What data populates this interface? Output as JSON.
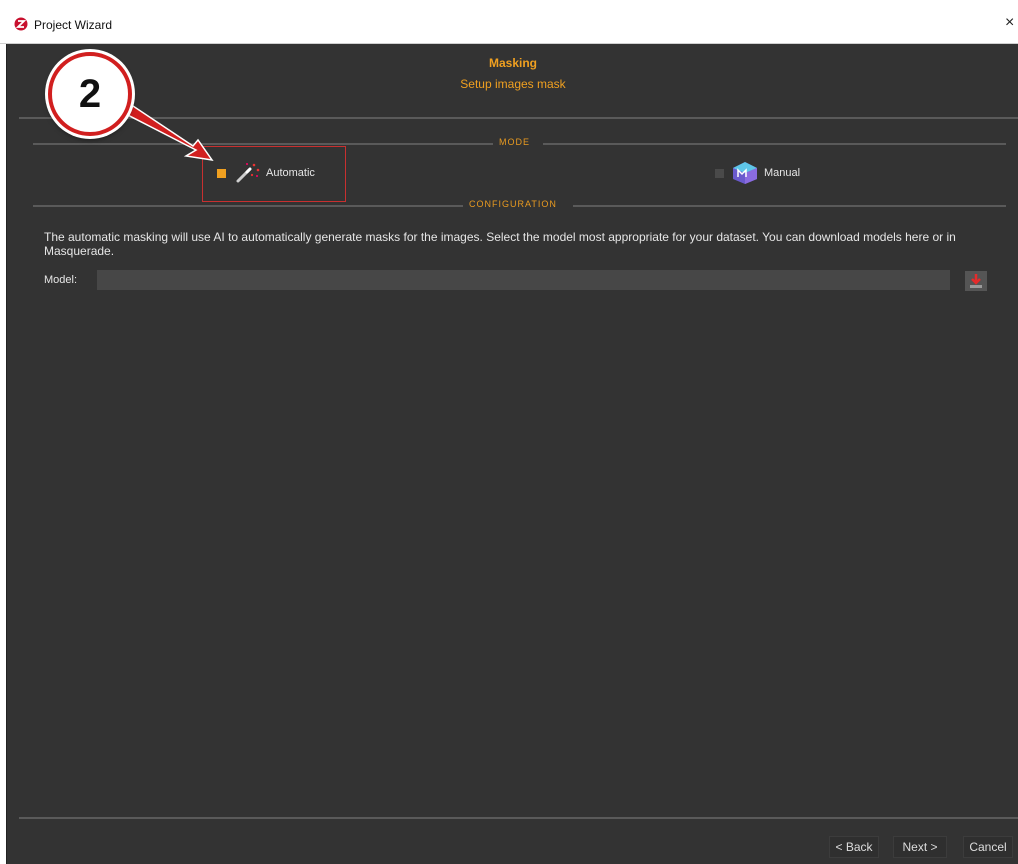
{
  "window": {
    "title": "Project Wizard",
    "close_glyph": "×"
  },
  "header": {
    "title": "Masking",
    "subtitle": "Setup images mask"
  },
  "mode_section": {
    "label": "MODE",
    "options": [
      {
        "label": "Automatic",
        "icon": "magic-wand-icon",
        "selected": true
      },
      {
        "label": "Manual",
        "icon": "manual-cube-icon",
        "selected": false
      }
    ]
  },
  "configuration_section": {
    "label": "CONFIGURATION",
    "description": "The automatic masking will use AI to automatically generate masks for the images. Select the model most appropriate for your dataset. You can download models here or in Masquerade.",
    "model_label": "Model:",
    "model_value": ""
  },
  "footer": {
    "back_label": "< Back",
    "next_label": "Next >",
    "cancel_label": "Cancel"
  },
  "annotation": {
    "step_number": "2"
  },
  "colors": {
    "accent": "#f0a020",
    "background": "#333333",
    "annotation_red": "#d11f1f"
  }
}
